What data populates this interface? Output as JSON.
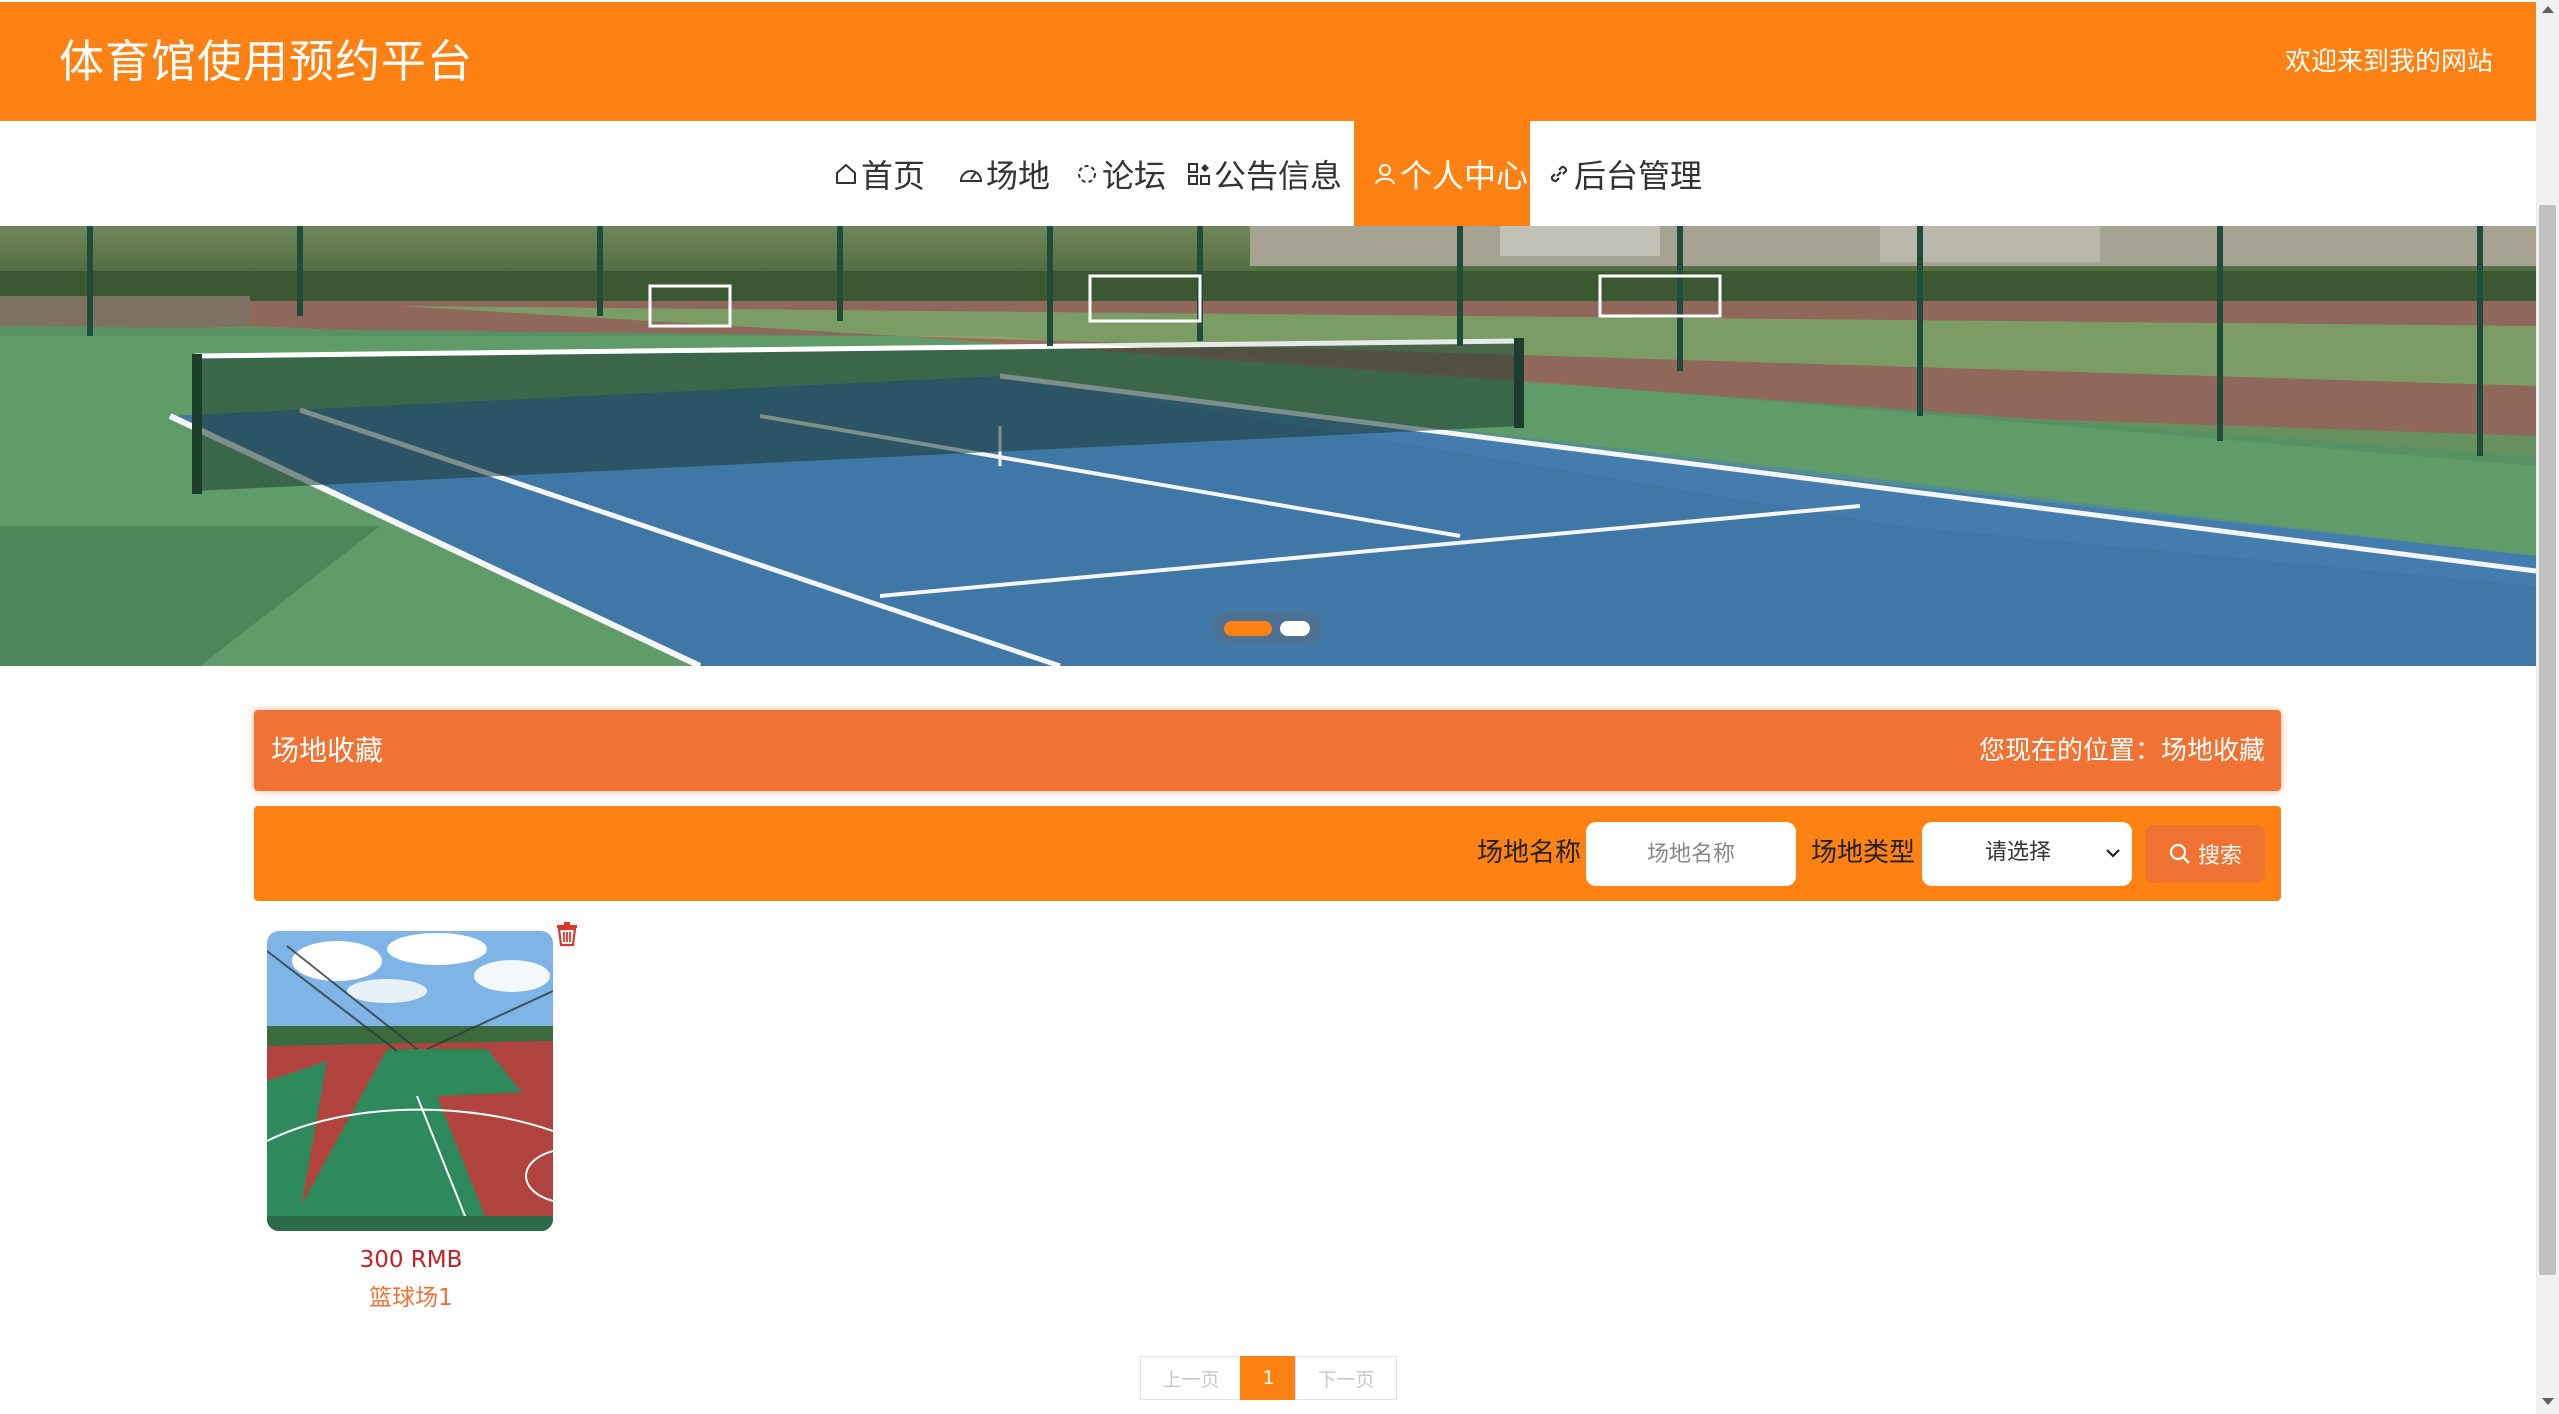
{
  "header": {
    "site_title": "体育馆使用预约平台",
    "welcome": "欢迎来到我的网站"
  },
  "nav": {
    "items": [
      {
        "label": "首页",
        "icon": "home-icon"
      },
      {
        "label": "场地",
        "icon": "gauge-icon"
      },
      {
        "label": "论坛",
        "icon": "forum-icon"
      },
      {
        "label": "公告信息",
        "icon": "apps-icon"
      },
      {
        "label": "个人中心",
        "icon": "user-icon"
      },
      {
        "label": "后台管理",
        "icon": "link-icon"
      }
    ],
    "active": "个人中心"
  },
  "carousel": {
    "slide_count": 2,
    "active_index": 0
  },
  "breadcrumb": {
    "title": "场地收藏",
    "location": "您现在的位置：场地收藏"
  },
  "search": {
    "name_label": "场地名称",
    "name_placeholder": "场地名称",
    "type_label": "场地类型",
    "type_value": "请选择",
    "button_label": "搜索"
  },
  "items": [
    {
      "price": "300 RMB",
      "name": "篮球场1"
    }
  ],
  "pagination": {
    "prev": "上一页",
    "current": "1",
    "next": "下一页"
  },
  "colors": {
    "primary": "#fd8213",
    "secondary": "#f07334",
    "price": "#c51f25"
  }
}
